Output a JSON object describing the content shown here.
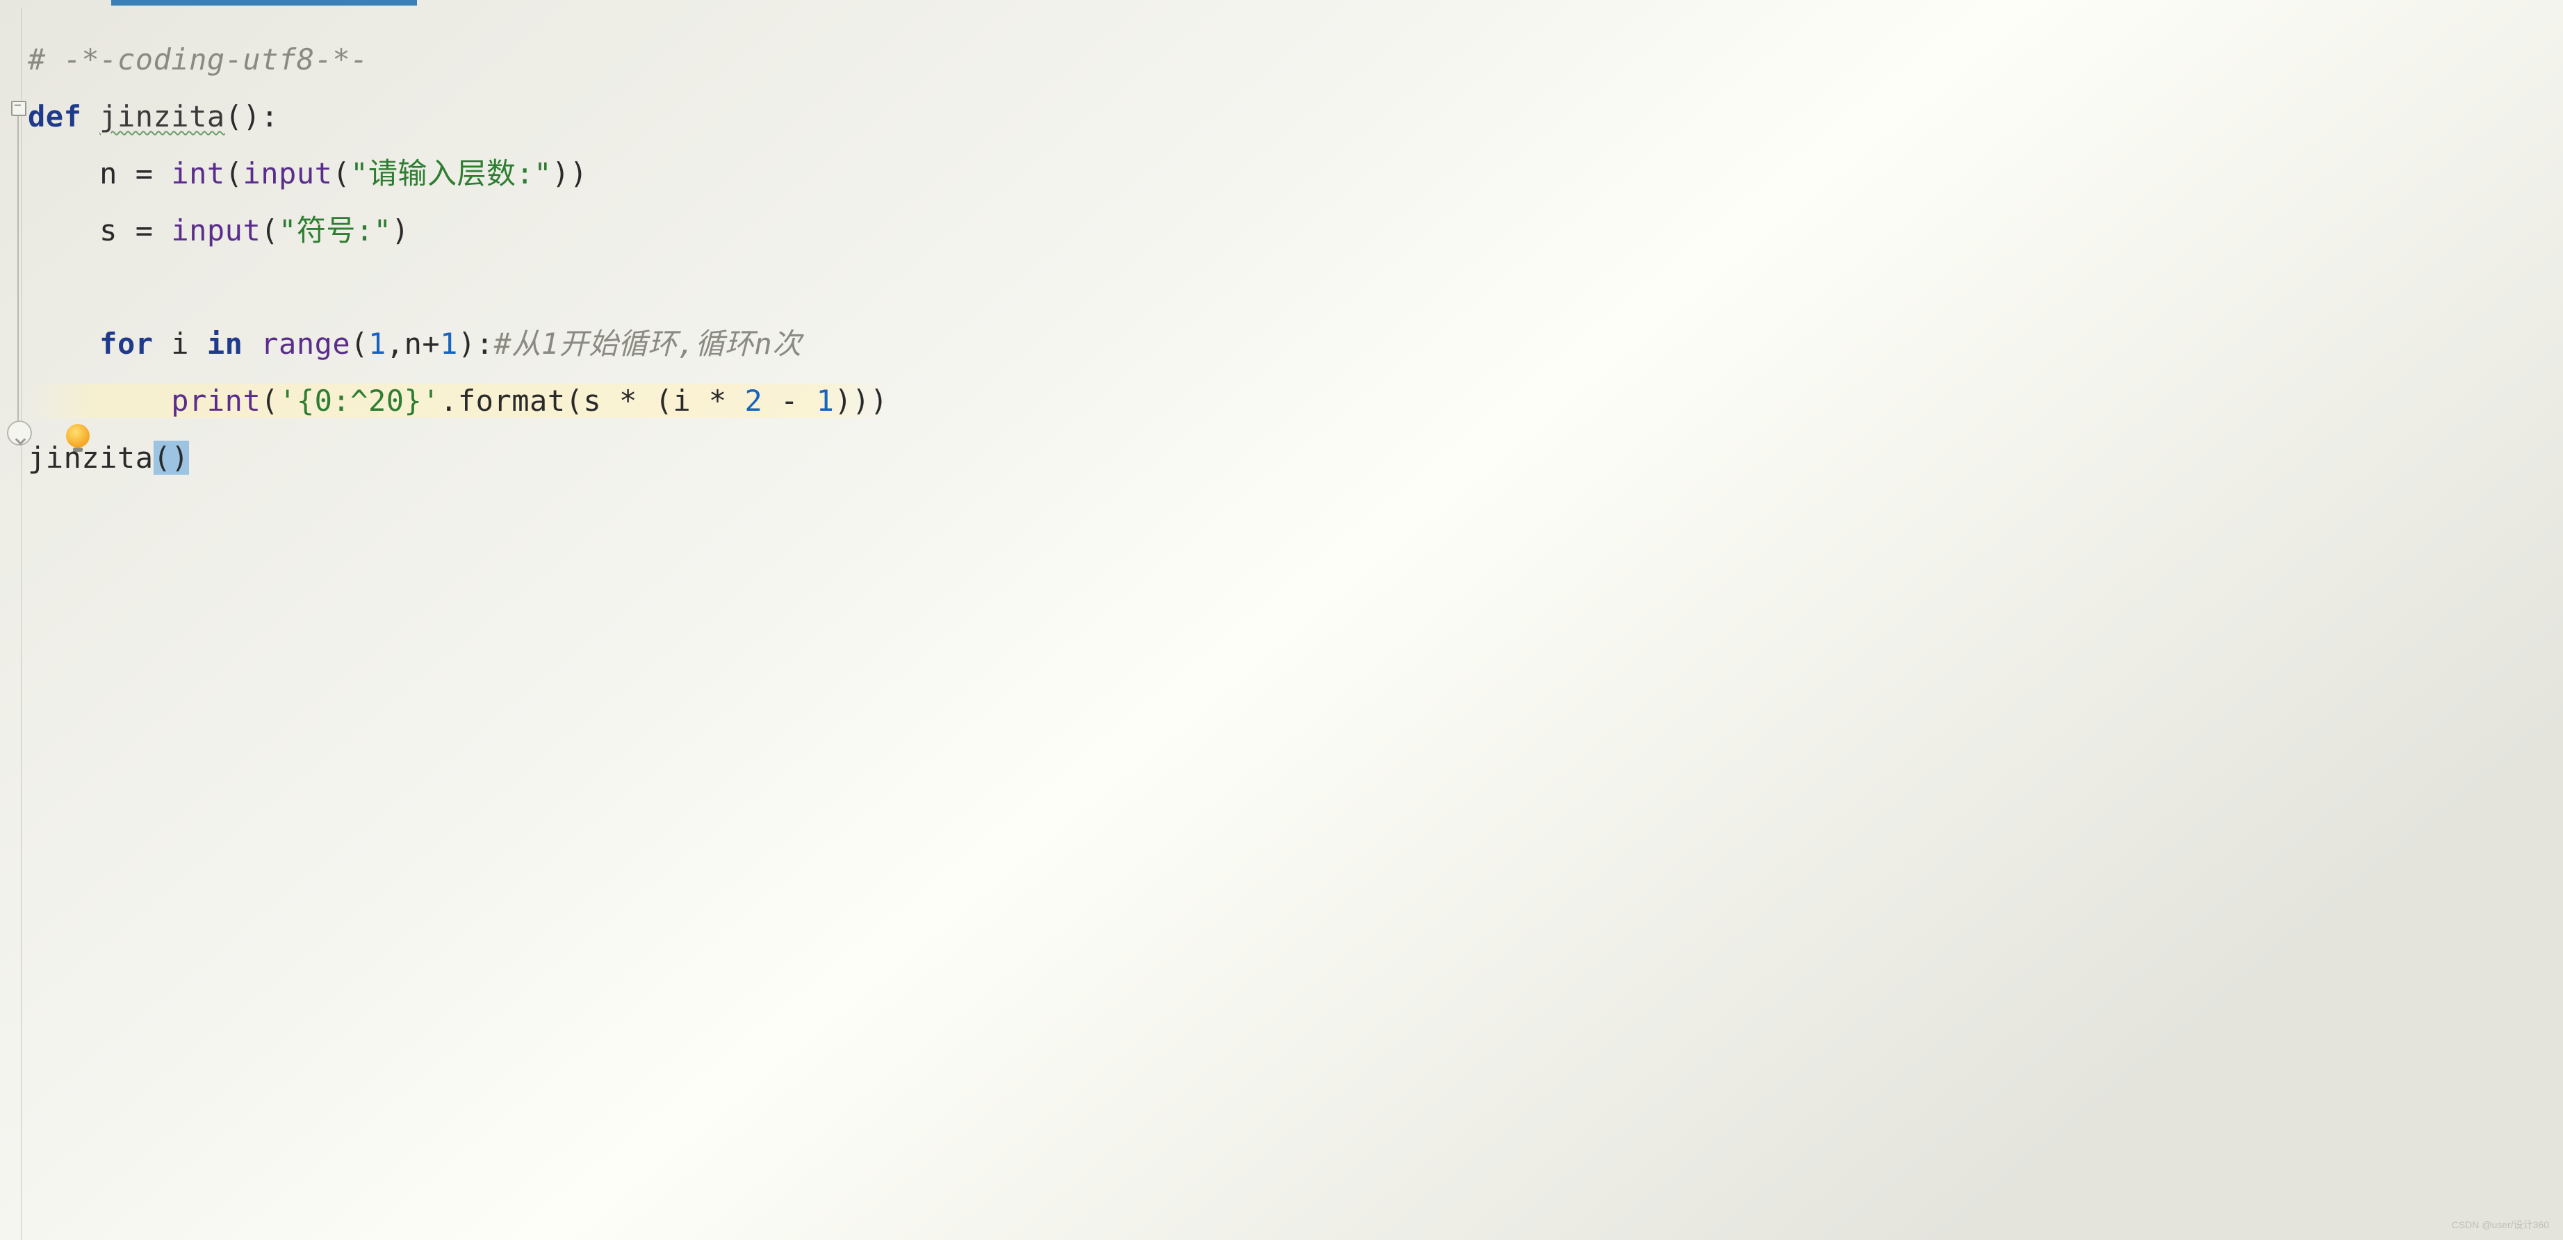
{
  "code": {
    "line1_comment": "# -*-coding-utf8-*-",
    "line2_def": "def",
    "line2_name": "jinzita",
    "line2_paren": "():",
    "line3_var": "n = ",
    "line3_int": "int",
    "line3_open": "(",
    "line3_input": "input",
    "line3_open2": "(",
    "line3_str": "\"请输入层数:\"",
    "line3_close": "))",
    "line4_var": "s = ",
    "line4_input": "input",
    "line4_open": "(",
    "line4_str": "\"符号:\"",
    "line4_close": ")",
    "line6_for": "for",
    "line6_i": " i ",
    "line6_in": "in",
    "line6_sp": " ",
    "line6_range": "range",
    "line6_open": "(",
    "line6_one": "1",
    "line6_comma": ",n+",
    "line6_one2": "1",
    "line6_close": "):",
    "line6_comment": "#从1开始循环,循环n次",
    "line7_print": "print",
    "line7_open": "(",
    "line7_str": "'{0:^20}'",
    "line7_fmt": ".format(s * (i * ",
    "line7_two": "2",
    "line7_minus": " - ",
    "line7_one": "1",
    "line7_close": ")))",
    "line8_call": "jinzita",
    "line8_paren": "()"
  },
  "watermark": "CSDN @user/设计360"
}
